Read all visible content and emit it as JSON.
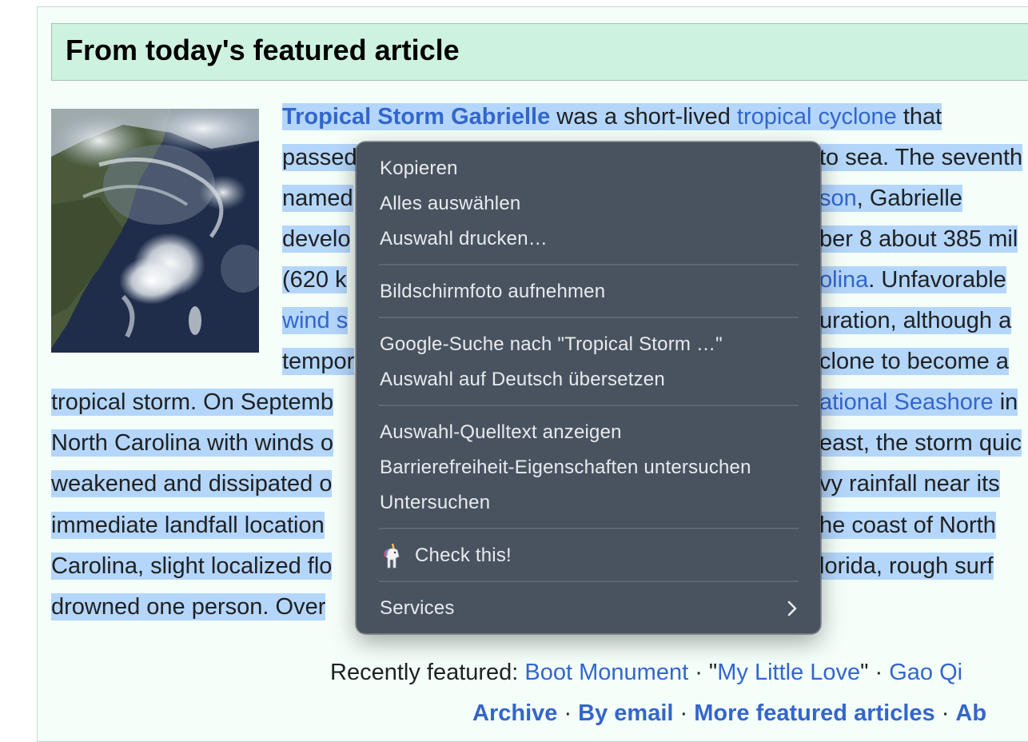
{
  "box": {
    "title": "From today's featured article"
  },
  "article": {
    "lines": [
      {
        "segments": [
          {
            "text": "Tropical Storm Gabrielle",
            "link": true,
            "bold": true
          },
          {
            "text": " was a short-lived "
          },
          {
            "text": "tropical cyclone",
            "link": true
          },
          {
            "text": " that "
          }
        ]
      },
      {
        "segments": [
          {
            "text": "passed"
          }
        ],
        "right": [
          {
            "text": "to sea. The seventh"
          }
        ]
      },
      {
        "segments": [
          {
            "text": "named"
          }
        ],
        "right": [
          {
            "text": "son",
            "link": true
          },
          {
            "text": ", Gabrielle "
          }
        ]
      },
      {
        "segments": [
          {
            "text": "develo"
          }
        ],
        "right": [
          {
            "text": "ber 8 about 385 mil"
          }
        ]
      },
      {
        "segments": [
          {
            "text": "(620 k"
          }
        ],
        "right": [
          {
            "text": "olina",
            "link": true
          },
          {
            "text": ". Unfavorable"
          }
        ]
      },
      {
        "segments": [
          {
            "text": "wind s",
            "link": true
          }
        ],
        "right": [
          {
            "text": "uration, although a"
          }
        ]
      },
      {
        "segments": [
          {
            "text": "tempor"
          }
        ],
        "right": [
          {
            "text": "clone to become a"
          }
        ]
      },
      {
        "segments": [
          {
            "text": "tropical storm. On Septemb"
          }
        ],
        "right": [
          {
            "text": "ational Seashore",
            "link": true
          },
          {
            "text": " in"
          }
        ]
      },
      {
        "segments": [
          {
            "text": "North Carolina with winds o"
          }
        ],
        "right": [
          {
            "text": "east, the storm quic"
          }
        ]
      },
      {
        "segments": [
          {
            "text": "weakened and dissipated o"
          }
        ],
        "right": [
          {
            "text": "vy rainfall near its "
          }
        ]
      },
      {
        "segments": [
          {
            "text": "immediate landfall location"
          }
        ],
        "right": [
          {
            "text": "he coast of North "
          }
        ]
      },
      {
        "segments": [
          {
            "text": "Carolina, slight localized flo"
          }
        ],
        "right": [
          {
            "text": "lorida, rough surf "
          }
        ]
      },
      {
        "segments": [
          {
            "text": "drowned one person. Over"
          }
        ]
      }
    ]
  },
  "footer": {
    "recently_label": "Recently featured: ",
    "recent_1": "Boot Monument",
    "sep_1": " · \"",
    "recent_2": "My Little Love",
    "sep_2": "\" · ",
    "recent_3": "Gao Qi",
    "archive": "Archive",
    "dot": " · ",
    "by_email": "By email",
    "more": "More featured articles",
    "about": "Ab"
  },
  "context_menu": {
    "items": [
      "Kopieren",
      "Alles auswählen",
      "Auswahl drucken…",
      "Bildschirmfoto aufnehmen",
      "Google-Suche nach \"Tropical Storm …\"",
      "Auswahl auf Deutsch übersetzen",
      "Auswahl-Quelltext anzeigen",
      "Barrierefreiheit-Eigenschaften untersuchen",
      "Untersuchen",
      "Check this!",
      "Services"
    ],
    "extension_icon": "unicorn-icon",
    "submenu_icon": "chevron-right-icon"
  },
  "colors": {
    "link": "#3366cc",
    "selection": "#b4d6fb",
    "header_bg": "#cef2e0",
    "menu_bg": "#424c59"
  }
}
